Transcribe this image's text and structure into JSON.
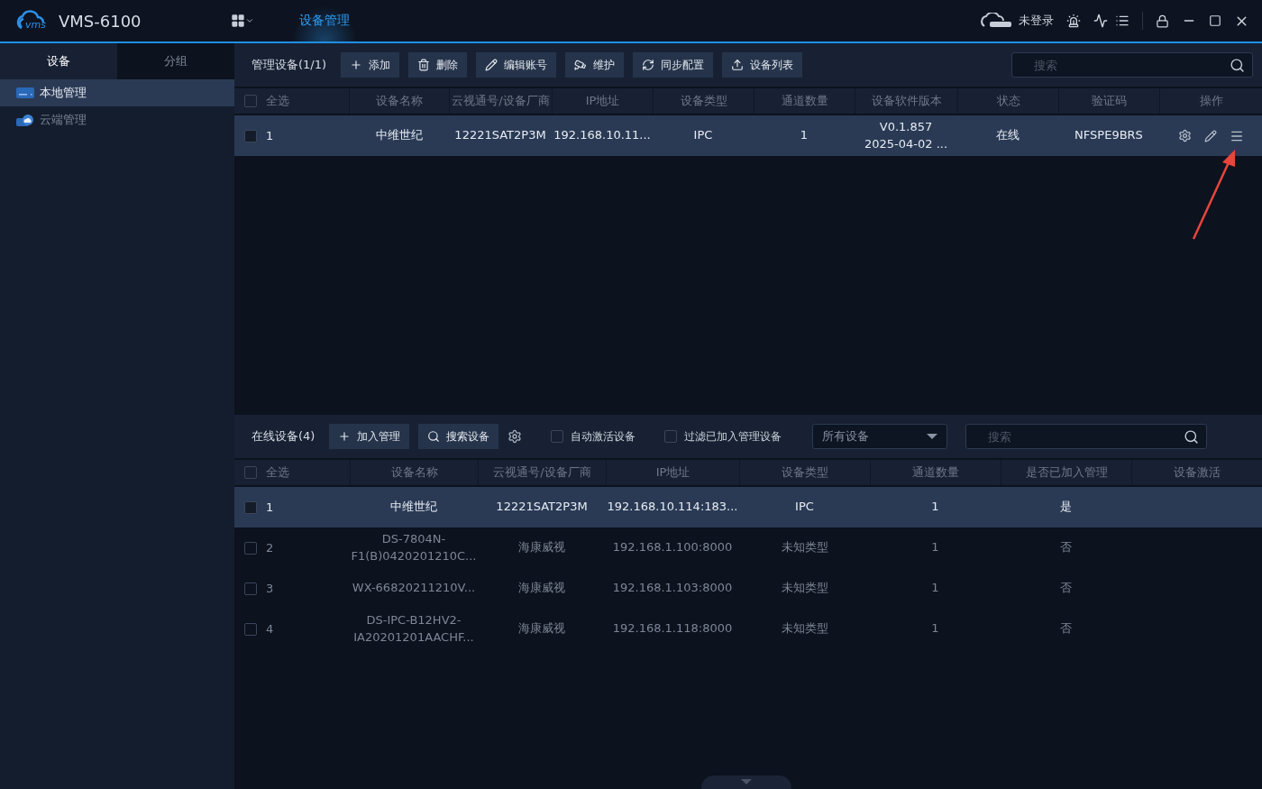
{
  "header": {
    "app_name": "VMS-6100",
    "logo_text": "vms",
    "tabs": [
      {
        "label": "设备管理",
        "selected": true
      }
    ],
    "login_status": "未登录"
  },
  "sidebar": {
    "tabs": [
      {
        "label": "设备",
        "selected": true
      },
      {
        "label": "分组",
        "selected": false
      }
    ],
    "items": [
      {
        "label": "本地管理",
        "kind": "local",
        "selected": true
      },
      {
        "label": "云端管理",
        "kind": "cloud",
        "selected": false
      }
    ]
  },
  "managed": {
    "title": "管理设备(1/1)",
    "buttons": [
      {
        "label": "添加",
        "kind": "add"
      },
      {
        "label": "删除",
        "kind": "delete"
      },
      {
        "label": "编辑账号",
        "kind": "edit"
      },
      {
        "label": "维护",
        "kind": "maintain"
      },
      {
        "label": "同步配置",
        "kind": "sync"
      },
      {
        "label": "设备列表",
        "kind": "export"
      }
    ],
    "search": {
      "placeholder": "搜索"
    },
    "select_all": {
      "label": "全选",
      "checked": false
    },
    "columns": [
      "设备名称",
      "云视通号/设备厂商",
      "IP地址",
      "设备类型",
      "通道数量",
      "设备软件版本",
      "状态",
      "验证码",
      "操作"
    ],
    "rows": [
      {
        "index": "1",
        "checked": false,
        "selected": true,
        "cells": [
          "中维世纪",
          "12221SAT2P3M",
          "192.168.10.11...",
          "IPC",
          "1",
          "V0.1.857\n2025-04-02 ...",
          "在线",
          "NFSPE9BRS"
        ]
      }
    ]
  },
  "online": {
    "title": "在线设备(4)",
    "buttons": [
      {
        "label": "加入管理",
        "kind": "add"
      },
      {
        "label": "搜索设备",
        "kind": "search"
      }
    ],
    "options": [
      {
        "label": "自动激活设备",
        "checked": false
      },
      {
        "label": "过滤已加入管理设备",
        "checked": false
      }
    ],
    "filter": "所有设备",
    "search": {
      "placeholder": "搜索"
    },
    "select_all": {
      "label": "全选",
      "checked": false
    },
    "columns": [
      "设备名称",
      "云视通号/设备厂商",
      "IP地址",
      "设备类型",
      "通道数量",
      "是否已加入管理",
      "设备激活"
    ],
    "rows": [
      {
        "index": "1",
        "checked": false,
        "selected": true,
        "cells": [
          "中维世纪",
          "12221SAT2P3M",
          "192.168.10.114:183...",
          "IPC",
          "1",
          "是",
          ""
        ]
      },
      {
        "index": "2",
        "checked": false,
        "selected": false,
        "cells": [
          "DS-7804N-\nF1(B)0420201210C...",
          "海康威视",
          "192.168.1.100:8000",
          "未知类型",
          "1",
          "否",
          ""
        ]
      },
      {
        "index": "3",
        "checked": false,
        "selected": false,
        "cells": [
          "WX-66820211210V...",
          "海康威视",
          "192.168.1.103:8000",
          "未知类型",
          "1",
          "否",
          ""
        ]
      },
      {
        "index": "4",
        "checked": false,
        "selected": false,
        "cells": [
          "DS-IPC-B12HV2-\nIA20201201AACHF...",
          "海康威视",
          "192.168.1.118:8000",
          "未知类型",
          "1",
          "否",
          ""
        ]
      }
    ]
  }
}
